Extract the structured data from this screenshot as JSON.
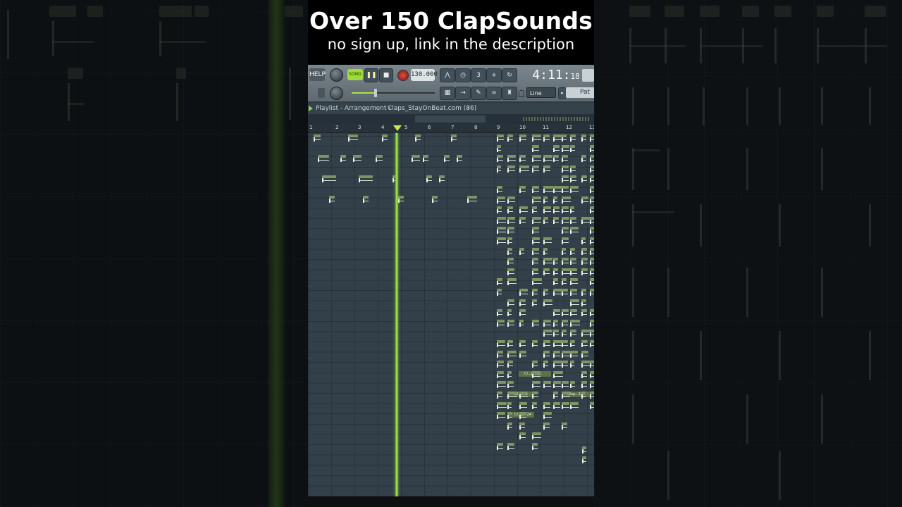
{
  "caption": {
    "title": "Over 150 ClapSounds",
    "subtitle": "no sign up, link in the description"
  },
  "toolbar": {
    "help": "HELP",
    "song": "SONG",
    "pause_icon": "pause-icon",
    "stop_icon": "stop-icon",
    "tempo": "130.000",
    "time": "4:11",
    "time_ticks": "18",
    "snap": "Line",
    "pattern": "Pat"
  },
  "playlist": {
    "title": "Playlist - Arrangement",
    "separator": "›",
    "pattern_name": "Claps_StayOnBeat.com (86)",
    "chevron": "›",
    "bars": [
      "1",
      "2",
      "3",
      "4",
      "5",
      "6",
      "7",
      "8",
      "9",
      "10",
      "11",
      "12",
      "13"
    ],
    "clip_labels": [
      "Cl...p...35",
      "Cl...i...2",
      "Clap...17",
      "Cl...p...24"
    ]
  },
  "colors": {
    "accent": "#a6e347",
    "clip_header": "#7d9463",
    "track_bg": "#33404a"
  }
}
